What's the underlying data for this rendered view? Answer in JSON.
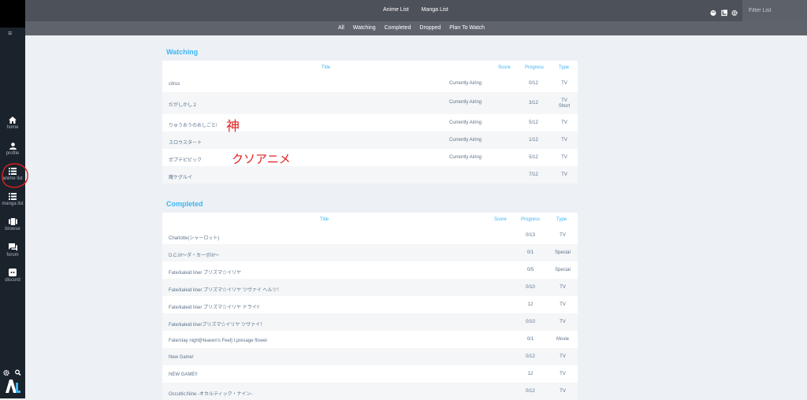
{
  "top_nav": {
    "anime_list": "Anime List",
    "manga_list": "Manga List"
  },
  "filter": {
    "placeholder": "Filter List"
  },
  "sub_tabs": [
    "All",
    "Watching",
    "Completed",
    "Dropped",
    "Plan To Watch"
  ],
  "sidebar": {
    "menu_icon": "≡",
    "items": [
      {
        "label": "home",
        "icon": "home-icon"
      },
      {
        "label": "profile",
        "icon": "user-icon"
      },
      {
        "label": "anime list",
        "icon": "list-icon"
      },
      {
        "label": "manga list",
        "icon": "list-icon"
      },
      {
        "label": "browse",
        "icon": "film-icon"
      },
      {
        "label": "forum",
        "icon": "chat-icon"
      },
      {
        "label": "discord",
        "icon": "discord-icon"
      }
    ]
  },
  "watching": {
    "title": "Watching",
    "headers": {
      "title": "Title",
      "score": "Score",
      "progress": "Progress",
      "type": "Type"
    },
    "rows": [
      {
        "title": "citrus",
        "status": "Currently Airing",
        "progress": "0/12",
        "type": "TV"
      },
      {
        "title": "だがしかし２",
        "status": "Currently Airing",
        "progress": "3/12",
        "type": "TV",
        "type2": "Short"
      },
      {
        "title": "りゅうおうのおしごと!",
        "status": "Currently Airing",
        "progress": "5/12",
        "type": "TV"
      },
      {
        "title": "スロウスタート",
        "status": "Currently Airing",
        "progress": "1/12",
        "type": "TV"
      },
      {
        "title": "ポプテピピック",
        "status": "Currently Airing",
        "progress": "5/12",
        "type": "TV"
      },
      {
        "title": "魔ケグルイ",
        "status": "",
        "progress": "7/12",
        "type": "TV"
      }
    ]
  },
  "completed": {
    "title": "Completed",
    "headers": {
      "title": "Title",
      "score": "Score",
      "progress": "Progress",
      "type": "Type"
    },
    "rows": [
      {
        "title": "Charlotte(シャーロット)",
        "progress": "0/13",
        "type": "TV"
      },
      {
        "title": "D.C.III〜ダ・カーポIII〜",
        "progress": "0/1",
        "type": "Special"
      },
      {
        "title": "Fate/kaleid liner プリズマ☆イリヤ",
        "progress": "0/5",
        "type": "Special"
      },
      {
        "title": "Fate/kaleid liner プリズマ☆イリヤ ツヴァイ ヘルツ！",
        "progress": "0/10",
        "type": "TV"
      },
      {
        "title": "Fate/kaleid liner プリズマ☆イリヤ ドライ!!",
        "progress": "12",
        "type": "TV"
      },
      {
        "title": "Fate/kaleid linerプリズマ☆イリヤ ツヴァイ！",
        "progress": "0/10",
        "type": "TV"
      },
      {
        "title": "Fate/stay night[Heaven's Feel] Ⅰ.presage flower",
        "progress": "0/1",
        "type": "Movie"
      },
      {
        "title": "New Game!",
        "progress": "0/12",
        "type": "TV"
      },
      {
        "title": "NEW GAME!!",
        "progress": "12",
        "type": "TV"
      },
      {
        "title": "Occultic;Nine -オカルティック・ナイン-",
        "progress": "0/12",
        "type": "TV"
      }
    ]
  },
  "annotations": {
    "kami": "神",
    "kusoanime": "クソアニメ"
  },
  "logo": {
    "text": "AL"
  },
  "colors": {
    "accent": "#3db4f2",
    "sidebar": "#1a222c",
    "annotation": "#e02020"
  }
}
